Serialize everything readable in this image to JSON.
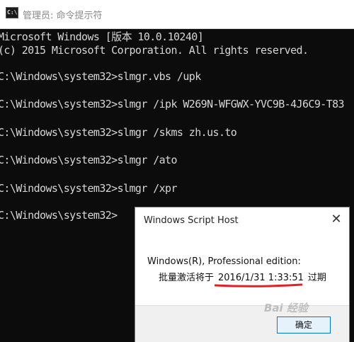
{
  "window": {
    "title": "管理员: 命令提示符",
    "icon": "cmd-icon"
  },
  "console": {
    "lines": [
      "Microsoft Windows [版本 10.0.10240]",
      "(c) 2015 Microsoft Corporation. All rights reserved.",
      "C:\\Windows\\system32>slmgr.vbs /upk",
      "C:\\Windows\\system32>slmgr /ipk W269N-WFGWX-YVC9B-4J6C9-T83",
      "C:\\Windows\\system32>slmgr /skms zh.us.to",
      "C:\\Windows\\system32>slmgr /ato",
      "C:\\Windows\\system32>slmgr /xpr",
      "C:\\Windows\\system32>"
    ]
  },
  "dialog": {
    "title": "Windows Script Host",
    "close_icon": "close-icon",
    "message_line1": "Windows(R), Professional edition:",
    "message_prefix": "批量激活将于",
    "expiry_date": "2016/1/31 1:33:51",
    "message_suffix": "过期",
    "ok_label": "确定",
    "underline_color": "#e0202a"
  },
  "watermark": {
    "text": "Bai 经验"
  },
  "colors": {
    "console_bg": "#0c0c0c",
    "console_text": "#d6d6d6",
    "titlebar_bg": "#ffffff",
    "accent": "#0078d7"
  }
}
